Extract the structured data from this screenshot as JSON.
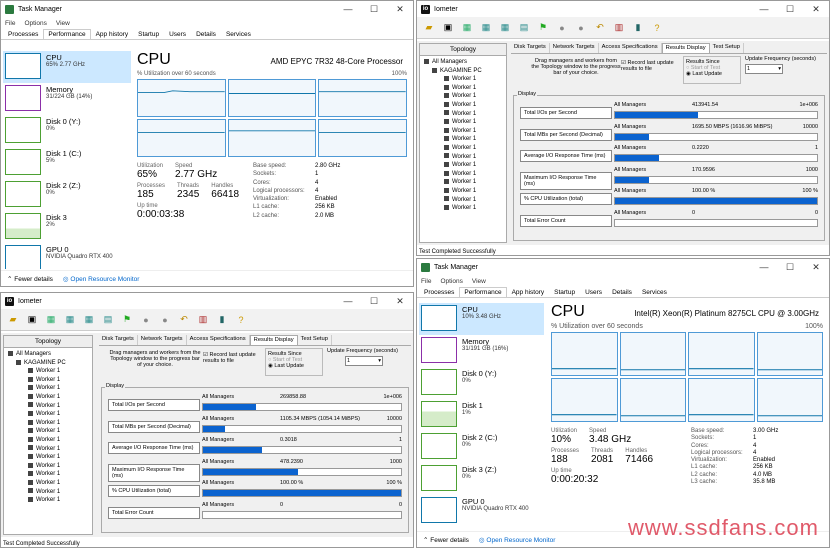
{
  "tm1": {
    "title": "Task Manager",
    "menu": [
      "File",
      "Options",
      "View"
    ],
    "tabs": [
      "Processes",
      "Performance",
      "App history",
      "Startup",
      "Users",
      "Details",
      "Services"
    ],
    "side": [
      {
        "label": "CPU",
        "sub": "65% 2.77 GHz",
        "sel": true
      },
      {
        "label": "Memory",
        "sub": "31/224 GB (14%)"
      },
      {
        "label": "Disk 0 (Y:)",
        "sub": "0%"
      },
      {
        "label": "Disk 1 (C:)",
        "sub": "5%"
      },
      {
        "label": "Disk 2 (Z:)",
        "sub": "0%"
      },
      {
        "label": "Disk 3",
        "sub": "2%"
      },
      {
        "label": "GPU 0",
        "sub": "NVIDIA Quadro RTX 400"
      }
    ],
    "cpu_title": "CPU",
    "model": "AMD EPYC 7R32 48-Core Processor",
    "util_label": "% Utilization over 60 seconds",
    "util_max": "100%",
    "utilization_k": "Utilization",
    "utilization": "65%",
    "speed_k": "Speed",
    "speed": "2.77 GHz",
    "processes_k": "Processes",
    "processes": "185",
    "threads_k": "Threads",
    "threads": "2345",
    "handles_k": "Handles",
    "handles": "66418",
    "uptime_k": "Up time",
    "uptime": "0:00:03:38",
    "kv": [
      [
        "Base speed:",
        "2.80 GHz"
      ],
      [
        "Sockets:",
        "1"
      ],
      [
        "Cores:",
        "4"
      ],
      [
        "Logical processors:",
        "4"
      ],
      [
        "Virtualization:",
        "Enabled"
      ],
      [
        "L1 cache:",
        "256 KB"
      ],
      [
        "L2 cache:",
        "2.0 MB"
      ]
    ],
    "fewer": "Fewer details",
    "resmon": "Open Resource Monitor"
  },
  "tm2": {
    "title": "Task Manager",
    "menu": [
      "File",
      "Options",
      "View"
    ],
    "tabs": [
      "Processes",
      "Performance",
      "App history",
      "Startup",
      "Users",
      "Details",
      "Services"
    ],
    "side": [
      {
        "label": "CPU",
        "sub": "10% 3.48 GHz",
        "sel": true
      },
      {
        "label": "Memory",
        "sub": "31/191 GB (16%)"
      },
      {
        "label": "Disk 0 (Y:)",
        "sub": "0%"
      },
      {
        "label": "Disk 1",
        "sub": "1%"
      },
      {
        "label": "Disk 2 (C:)",
        "sub": "0%"
      },
      {
        "label": "Disk 3 (Z:)",
        "sub": "0%"
      },
      {
        "label": "GPU 0",
        "sub": "NVIDIA Quadro RTX 400"
      }
    ],
    "cpu_title": "CPU",
    "model": "Intel(R) Xeon(R) Platinum 8275CL CPU @ 3.00GHz",
    "util_label": "% Utilization over 60 seconds",
    "util_max": "100%",
    "utilization_k": "Utilization",
    "utilization": "10%",
    "speed_k": "Speed",
    "speed": "3.48 GHz",
    "processes_k": "Processes",
    "processes": "188",
    "threads_k": "Threads",
    "threads": "2081",
    "handles_k": "Handles",
    "handles": "71466",
    "uptime_k": "Up time",
    "uptime": "0:00:20:32",
    "kv": [
      [
        "Base speed:",
        "3.00 GHz"
      ],
      [
        "Sockets:",
        "1"
      ],
      [
        "Cores:",
        "4"
      ],
      [
        "Logical processors:",
        "4"
      ],
      [
        "Virtualization:",
        "Enabled"
      ],
      [
        "L1 cache:",
        "256 KB"
      ],
      [
        "L2 cache:",
        "4.0 MB"
      ],
      [
        "L3 cache:",
        "35.8 MB"
      ]
    ],
    "fewer": "Fewer details",
    "resmon": "Open Resource Monitor"
  },
  "io1": {
    "title": "Iometer",
    "topology": "Topology",
    "all": "All Managers",
    "pc": "KAGAMINE PC",
    "worker": "Worker 1",
    "worker_count": 16,
    "tabs": [
      "Disk Targets",
      "Network Targets",
      "Access Specifications",
      "Results Display",
      "Test Setup"
    ],
    "drag_text": "Drag managers and workers from the Topology window to the progress bar of your choice.",
    "record": "Record last update results to file",
    "results_since": "Results Since",
    "start_of_test": "Start of Test",
    "last_update": "Last Update",
    "update_freq": "Update Frequency (seconds)",
    "update_value": "1",
    "display": "Display",
    "rows": [
      {
        "btn": "Total I/Os per Second",
        "mgr": "All Managers",
        "val": "269858.88",
        "max": "1e+006",
        "fill": 27
      },
      {
        "btn": "Total MBs per Second (Decimal)",
        "mgr": "All Managers",
        "val": "1105.34 MBPS (1054.14 MiBPS)",
        "max": "10000",
        "fill": 11
      },
      {
        "btn": "Average I/O Response Time (ms)",
        "mgr": "All Managers",
        "val": "0.3018",
        "max": "1",
        "fill": 30
      },
      {
        "btn": "Maximum I/O Response Time (ms)",
        "mgr": "All Managers",
        "val": "478.2390",
        "max": "1000",
        "fill": 48
      },
      {
        "btn": "% CPU Utilization (total)",
        "mgr": "All Managers",
        "val": "100.00 %",
        "max": "100 %",
        "fill": 100
      },
      {
        "btn": "Total Error Count",
        "mgr": "All Managers",
        "val": "0",
        "max": "0",
        "fill": 0
      }
    ],
    "status": "Test Completed Successfully"
  },
  "io2": {
    "title": "Iometer",
    "topology": "Topology",
    "all": "All Managers",
    "pc": "KAGAMINE PC",
    "worker": "Worker 1",
    "worker_count": 16,
    "tabs": [
      "Disk Targets",
      "Network Targets",
      "Access Specifications",
      "Results Display",
      "Test Setup"
    ],
    "drag_text": "Drag managers and workers from the Topology window to the progress bar of your choice.",
    "record": "Record last update results to file",
    "results_since": "Results Since",
    "start_of_test": "Start of Test",
    "last_update": "Last Update",
    "update_freq": "Update Frequency (seconds)",
    "update_value": "1",
    "display": "Display",
    "rows": [
      {
        "btn": "Total I/Os per Second",
        "mgr": "All Managers",
        "val": "413941.54",
        "max": "1e+006",
        "fill": 41
      },
      {
        "btn": "Total MBs per Second (Decimal)",
        "mgr": "All Managers",
        "val": "1695.50 MBPS (1616.96 MiBPS)",
        "max": "10000",
        "fill": 17
      },
      {
        "btn": "Average I/O Response Time (ms)",
        "mgr": "All Managers",
        "val": "0.2220",
        "max": "1",
        "fill": 22
      },
      {
        "btn": "Maximum I/O Response Time (ms)",
        "mgr": "All Managers",
        "val": "170.9596",
        "max": "1000",
        "fill": 17
      },
      {
        "btn": "% CPU Utilization (total)",
        "mgr": "All Managers",
        "val": "100.00 %",
        "max": "100 %",
        "fill": 100
      },
      {
        "btn": "Total Error Count",
        "mgr": "All Managers",
        "val": "0",
        "max": "0",
        "fill": 0
      }
    ],
    "status": "Test Completed Successfully"
  },
  "watermark": "www.ssdfans.com"
}
